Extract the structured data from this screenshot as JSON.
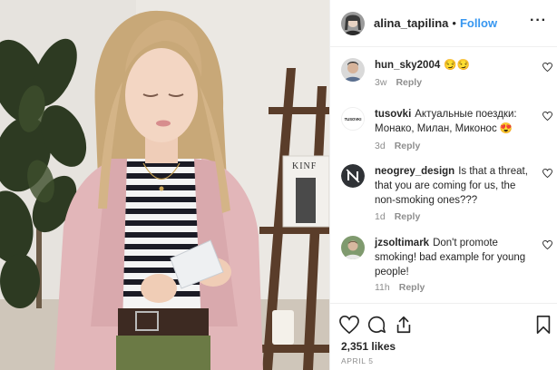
{
  "post": {
    "username": "alina_tapilina",
    "separator": "•",
    "follow_label": "Follow",
    "more_label": "···"
  },
  "photo": {
    "box_label": "KINF"
  },
  "comments": [
    {
      "username": "hun_sky2004",
      "text": "😏😏",
      "time": "3w",
      "reply_label": "Reply",
      "avatar": "portrait-man-avatar"
    },
    {
      "username": "tusovki",
      "text": "Актуальные поездки: Монако, Милан, Миконос 😍",
      "time": "3d",
      "reply_label": "Reply",
      "avatar": "tusovki-logo-avatar",
      "avatar_text": "TUSOVKI"
    },
    {
      "username": "neogrey_design",
      "text": "Is that a threat, that you are coming for us, the non-smoking ones???",
      "time": "1d",
      "reply_label": "Reply",
      "avatar": "n-logo-avatar"
    },
    {
      "username": "jzsoltimark",
      "text": "Don't promote smoking! bad example for young people!",
      "time": "11h",
      "reply_label": "Reply",
      "avatar": "portrait-avatar"
    }
  ],
  "footer": {
    "likes": "2,351 likes",
    "date": "APRIL 5"
  },
  "colors": {
    "accent": "#3897f0",
    "text": "#262626",
    "muted": "#8e8e8e",
    "border": "#efefef"
  }
}
